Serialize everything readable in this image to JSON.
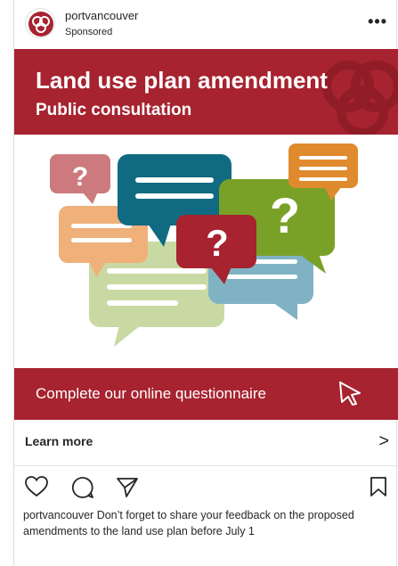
{
  "header": {
    "handle": "portvancouver",
    "sponsored": "Sponsored",
    "more": "•••"
  },
  "ad": {
    "title": "Land use plan amendment",
    "subtitle": "Public consultation",
    "cta": "Complete our online questionnaire",
    "bubble_marks": [
      "?",
      "?",
      "?"
    ]
  },
  "learn_more": {
    "label": "Learn more",
    "chevron": ">"
  },
  "actions": {
    "icons": [
      "heart-icon",
      "comment-icon",
      "share-icon",
      "bookmark-icon"
    ]
  },
  "caption": {
    "user": "portvancouver",
    "text": " Don’t forget to share your feedback on the proposed amendments to the land use plan before July 1"
  },
  "colors": {
    "brand_red": "#a6232f",
    "teal": "#0f6a82",
    "green": "#79a127",
    "orange": "#e08a2e",
    "peach": "#efb07a",
    "pink": "#cc7a7d",
    "sage": "#c9d9a4",
    "light_blue": "#7fb3c4"
  }
}
